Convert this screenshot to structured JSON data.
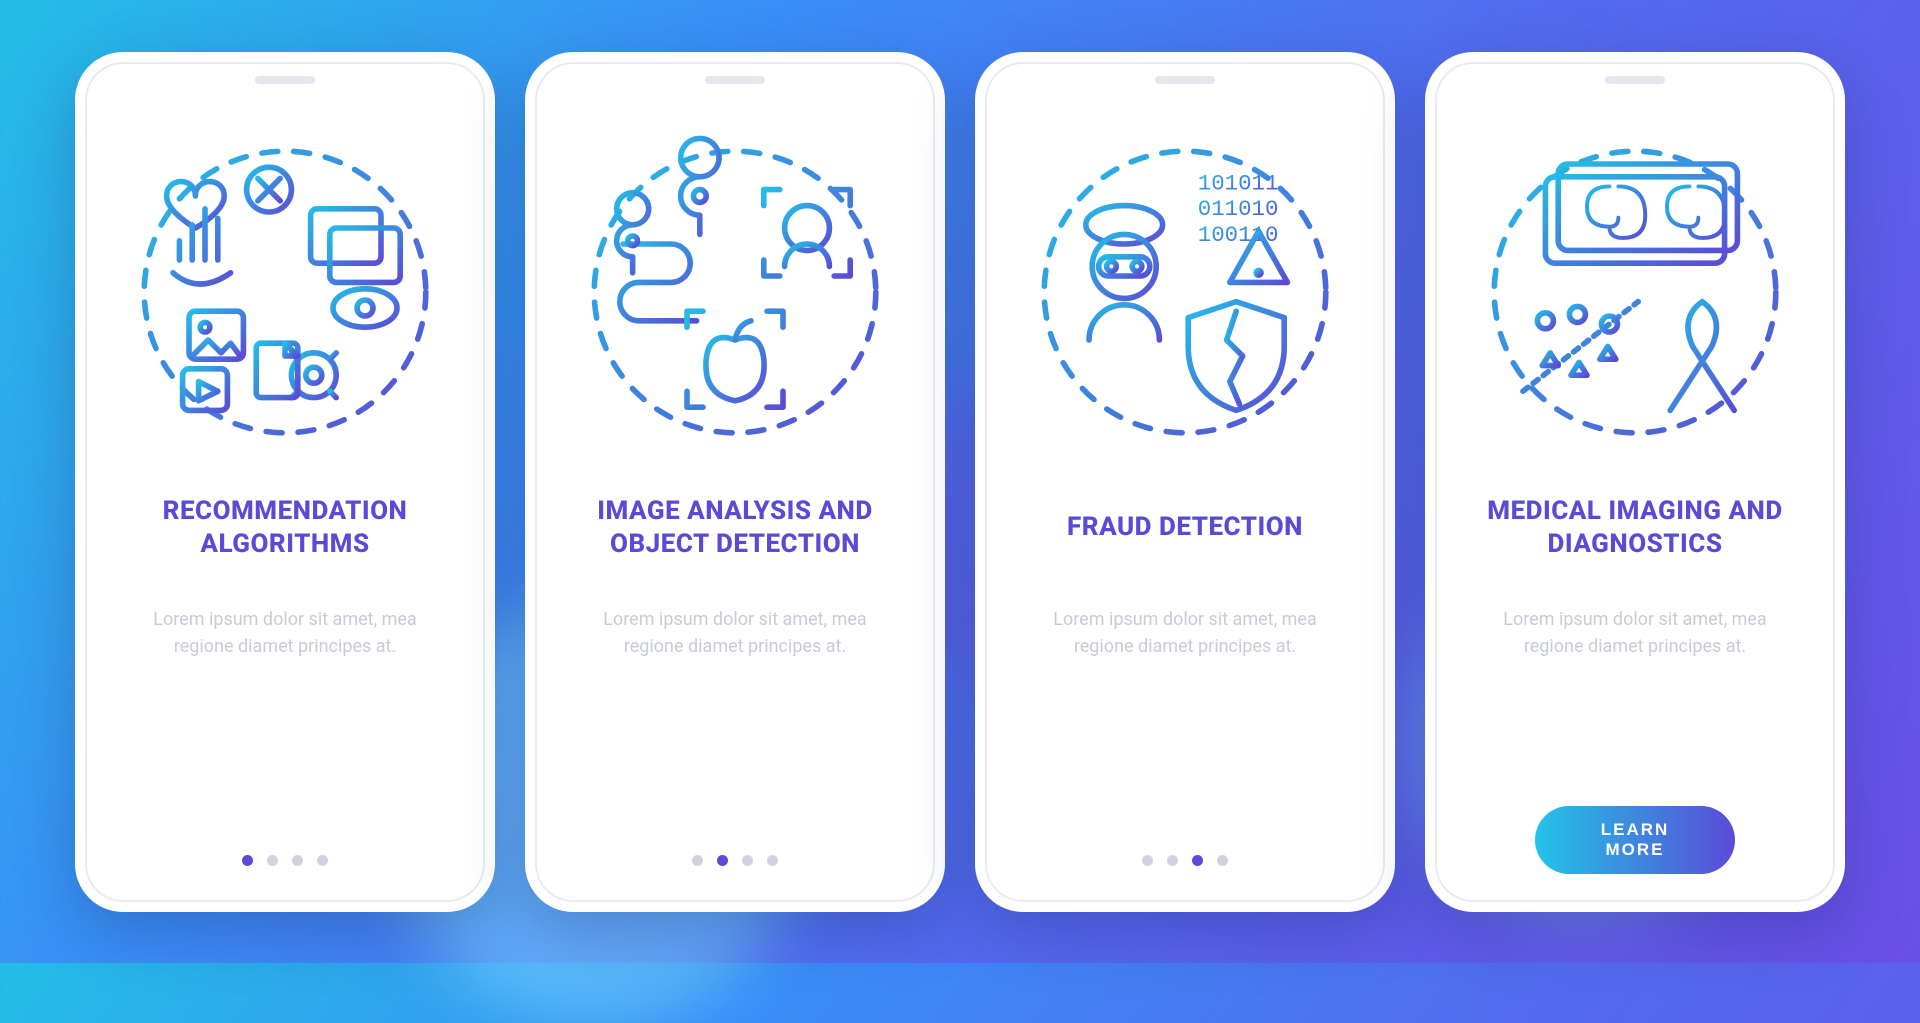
{
  "palette": {
    "accent": "#5a4bd6",
    "cta_gradient_start": "#22c4e8",
    "cta_gradient_end": "#5a4bd6",
    "text_muted": "#c7cbd8",
    "bg_gradient": [
      "#24bde6",
      "#3a8ef7",
      "#526bf0",
      "#6a4ee8"
    ]
  },
  "cta_label": "LEARN MORE",
  "screens": [
    {
      "icon": "engagement-icon",
      "title": "RECOMMENDATION ALGORITHMS",
      "description": "Lorem ipsum dolor sit amet, mea regione diamet principes at.",
      "page_total": 4,
      "page_active": 0,
      "has_cta": false
    },
    {
      "icon": "image-analysis-icon",
      "title": "IMAGE ANALYSIS AND OBJECT DETECTION",
      "description": "Lorem ipsum dolor sit amet, mea regione diamet principes at.",
      "page_total": 4,
      "page_active": 1,
      "has_cta": false
    },
    {
      "icon": "fraud-detection-icon",
      "title": "FRAUD DETECTION",
      "description": "Lorem ipsum dolor sit amet, mea regione diamet principes at.",
      "page_total": 4,
      "page_active": 2,
      "has_cta": false
    },
    {
      "icon": "medical-imaging-icon",
      "title": "MEDICAL IMAGING AND DIAGNOSTICS",
      "description": "Lorem ipsum dolor sit amet, mea regione diamet principes at.",
      "page_total": 4,
      "page_active": 3,
      "has_cta": true
    }
  ]
}
